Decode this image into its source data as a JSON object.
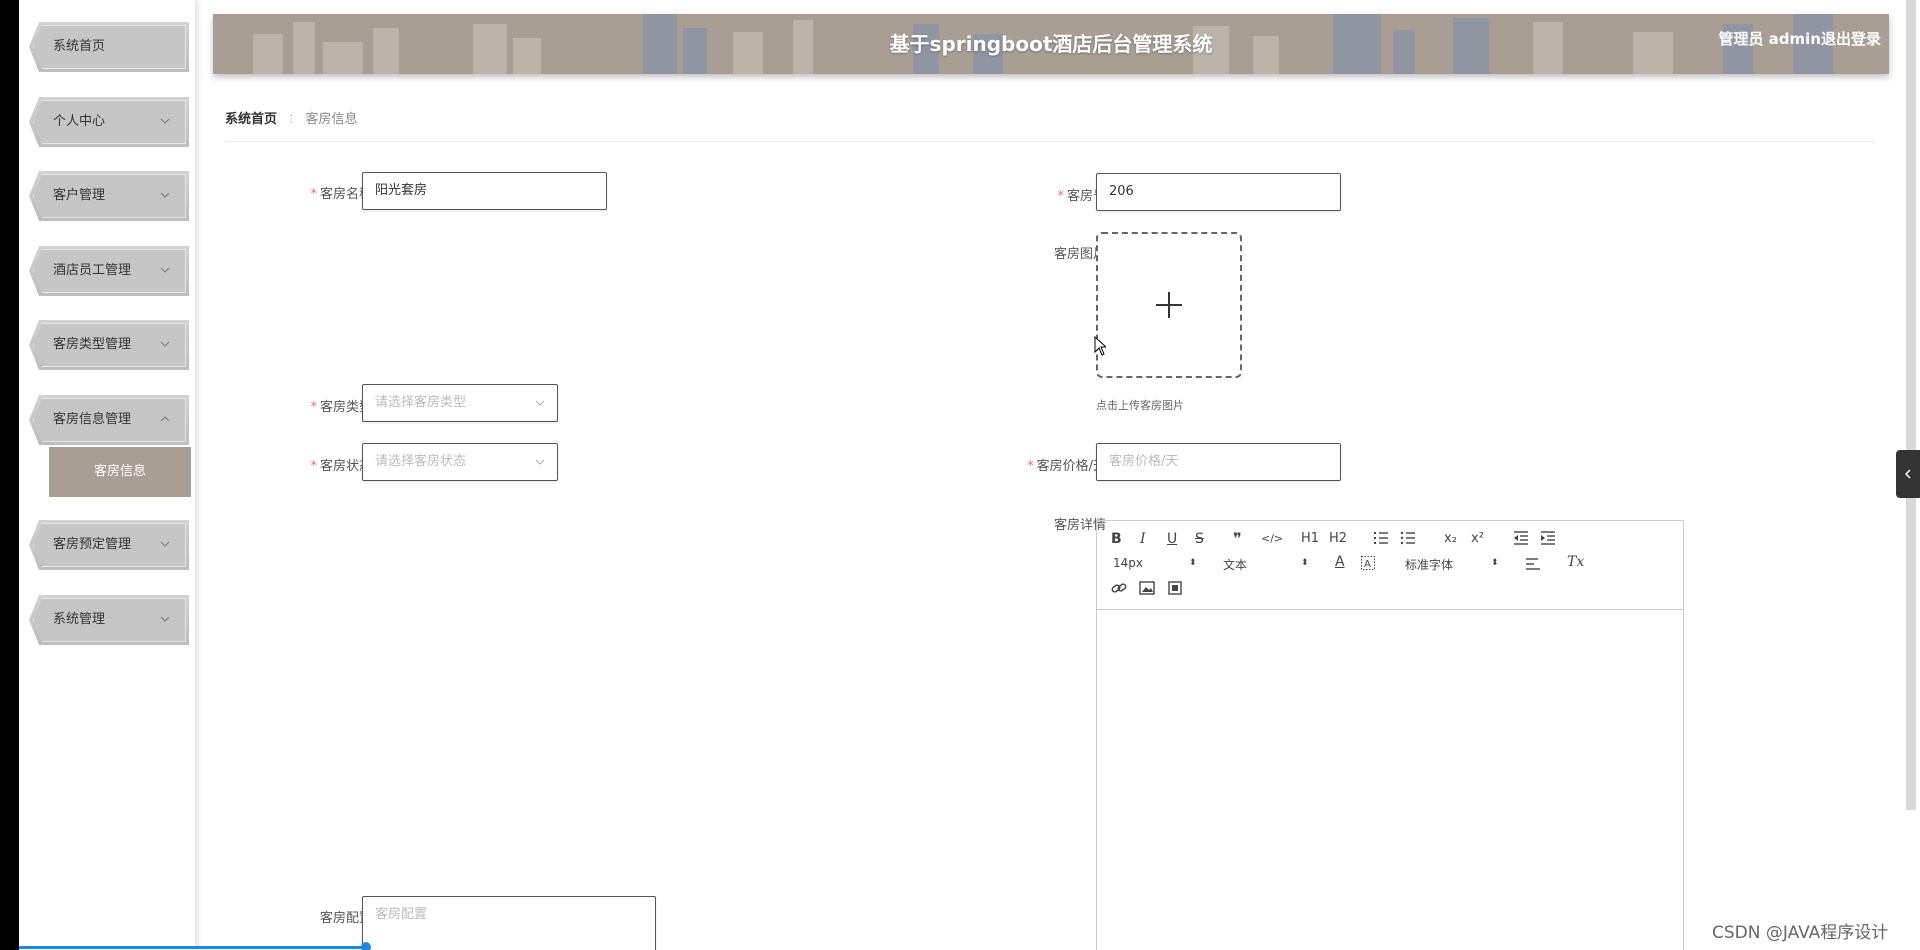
{
  "sidebar": {
    "items": [
      {
        "label": "系统首页",
        "expandable": false
      },
      {
        "label": "个人中心",
        "expandable": true
      },
      {
        "label": "客户管理",
        "expandable": true
      },
      {
        "label": "酒店员工管理",
        "expandable": true
      },
      {
        "label": "客房类型管理",
        "expandable": true
      },
      {
        "label": "客房信息管理",
        "expandable": true,
        "expanded": true
      },
      {
        "label": "客房预定管理",
        "expandable": true
      },
      {
        "label": "系统管理",
        "expandable": true
      }
    ],
    "submenu": {
      "label": "客房信息"
    }
  },
  "header": {
    "title": "基于springboot酒店后台管理系统",
    "user": "管理员 admin",
    "logout": "退出登录"
  },
  "breadcrumb": {
    "home": "系统首页",
    "separator": "⁝",
    "current": "客房信息"
  },
  "form": {
    "room_name": {
      "label": "客房名称",
      "value": "阳光套房",
      "required": true
    },
    "room_number": {
      "label": "客房号",
      "value": "206",
      "required": true
    },
    "room_image": {
      "label": "客房图片",
      "tip": "点击上传客房图片"
    },
    "room_type": {
      "label": "客房类型",
      "placeholder": "请选择客房类型",
      "required": true
    },
    "room_status": {
      "label": "客房状态",
      "placeholder": "请选择客房状态",
      "required": true
    },
    "room_price": {
      "label": "客房价格/天",
      "placeholder": "客房价格/天",
      "required": true
    },
    "room_detail": {
      "label": "客房详情"
    },
    "room_config": {
      "label": "客房配置",
      "placeholder": "客房配置"
    }
  },
  "editor": {
    "font_size": "14px",
    "header_select": "文本",
    "font_family": "标准字体",
    "h1": "H1",
    "h2": "H2",
    "bold": "B",
    "italic": "I",
    "underline": "U",
    "strike": "S",
    "quote": "❞",
    "code": "</>",
    "sub": "x₂",
    "sup": "x²",
    "color": "A",
    "clean": "Tx"
  },
  "watermark": "CSDN @JAVA程序设计",
  "colors": {
    "accent": "#a89e94",
    "required": "#f56c6c"
  }
}
